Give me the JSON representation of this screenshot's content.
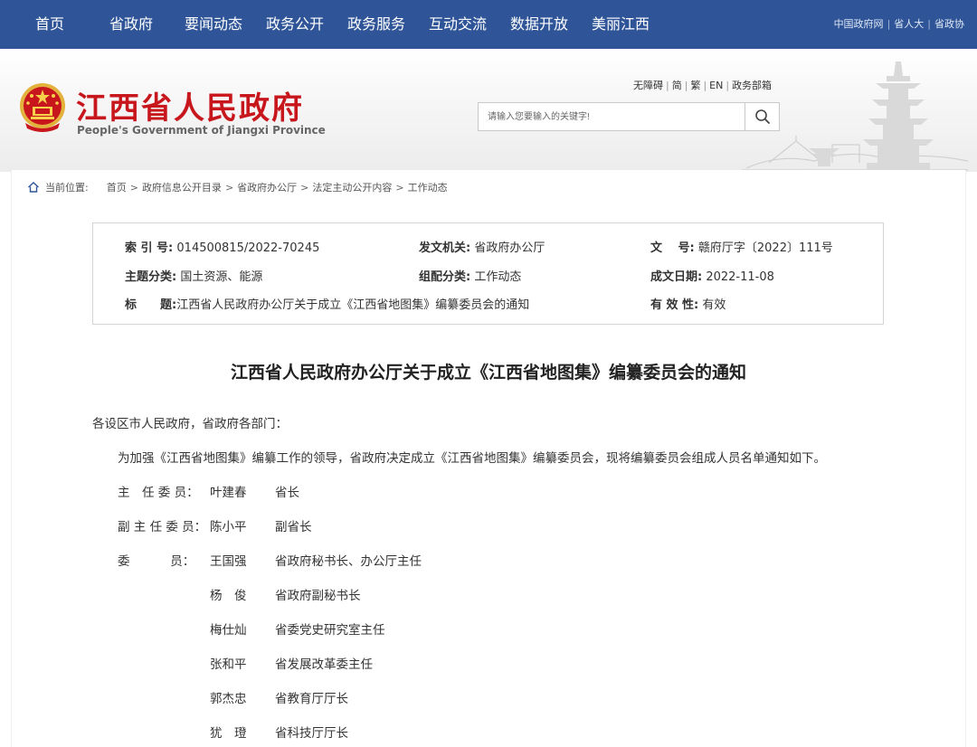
{
  "topnav": {
    "items": [
      "首页",
      "省政府",
      "要闻动态",
      "政务公开",
      "政务服务",
      "互动交流",
      "数据开放",
      "美丽江西"
    ],
    "links": [
      "中国政府网",
      "省人大",
      "省政协"
    ]
  },
  "header": {
    "title": "江西省人民政府",
    "subtitle": "People's Government of Jiangxi Province",
    "access_links": [
      "无障碍",
      "简",
      "繁",
      "EN",
      "政务部箱"
    ],
    "search_placeholder": "请输入您要输入的关键字!"
  },
  "breadcrumb": {
    "label": "当前位置:",
    "items": [
      "首页",
      "政府信息公开目录",
      "省政府办公厅",
      "法定主动公开内容",
      "工作动态"
    ]
  },
  "meta": {
    "index_label": "索 引 号:",
    "index_value": "014500815/2022-70245",
    "issuer_label": "发文机关:",
    "issuer_value": "省政府办公厅",
    "docno_label": "文　 号:",
    "docno_value": "赣府厅字〔2022〕111号",
    "topic_label": "主题分类:",
    "topic_value": "国土资源、能源",
    "group_label": "组配分类:",
    "group_value": "工作动态",
    "date_label": "成文日期:",
    "date_value": "2022-11-08",
    "title_label": "标　　题:",
    "title_value": "江西省人民政府办公厅关于成立《江西省地图集》编纂委员会的通知",
    "valid_label": "有 效 性:",
    "valid_value": "有效"
  },
  "document": {
    "title": "江西省人民政府办公厅关于成立《江西省地图集》编纂委员会的通知",
    "salutation": "各设区市人民政府，省政府各部门：",
    "intro": "为加强《江西省地图集》编纂工作的领导，省政府决定成立《江西省地图集》编纂委员会，现将编纂委员会组成人员名单通知如下。",
    "members": [
      {
        "role": "主　任 委 员：",
        "name": "叶建春",
        "position": "省长"
      },
      {
        "role": "副 主 任 委 员：",
        "name": "陈小平",
        "position": "副省长"
      },
      {
        "role": "委　　　 员：",
        "name": "王国强",
        "position": "省政府秘书长、办公厅主任"
      },
      {
        "role": "",
        "name": "杨　俊",
        "position": "省政府副秘书长"
      },
      {
        "role": "",
        "name": "梅仕灿",
        "position": "省委党史研究室主任"
      },
      {
        "role": "",
        "name": "张和平",
        "position": "省发展改革委主任"
      },
      {
        "role": "",
        "name": "郭杰忠",
        "position": "省教育厅厅长"
      },
      {
        "role": "",
        "name": "犹　璒",
        "position": "省科技厅厅长"
      }
    ]
  },
  "colors": {
    "nav_bg": "#2f5598",
    "title_red": "#c8161d"
  }
}
